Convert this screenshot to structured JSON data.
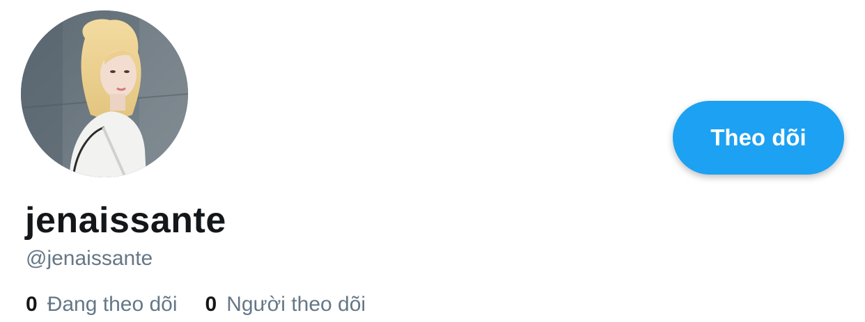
{
  "profile": {
    "display_name": "jenaissante",
    "handle": "@jenaissante",
    "avatar_alt": "profile-photo"
  },
  "actions": {
    "follow_label": "Theo dõi"
  },
  "stats": {
    "following": {
      "count": "0",
      "label": "Đang theo dõi"
    },
    "followers": {
      "count": "0",
      "label": "Người theo dõi"
    }
  },
  "colors": {
    "accent": "#1da1f2",
    "text_primary": "#14171a",
    "text_secondary": "#657786"
  }
}
